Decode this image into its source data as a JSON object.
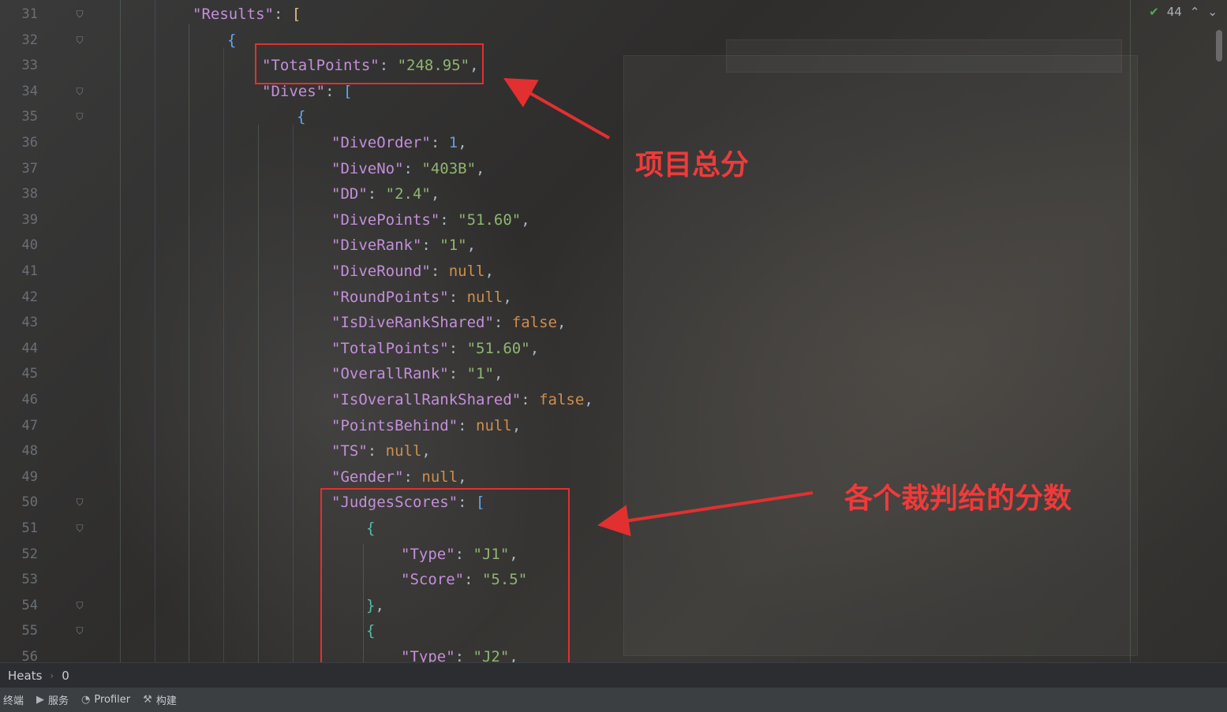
{
  "editor": {
    "line_numbers": [
      "31",
      "32",
      "33",
      "34",
      "35",
      "36",
      "37",
      "38",
      "39",
      "40",
      "41",
      "42",
      "43",
      "44",
      "45",
      "46",
      "47",
      "48",
      "49",
      "50",
      "51",
      "52",
      "53",
      "54",
      "55",
      "56"
    ],
    "lines": [
      {
        "indent": 0,
        "tokens": [
          [
            "k",
            "\"Results\""
          ],
          [
            "p",
            ": "
          ],
          [
            "br1",
            "["
          ]
        ]
      },
      {
        "indent": 1,
        "tokens": [
          [
            "br2",
            "{"
          ]
        ]
      },
      {
        "indent": 2,
        "tokens": [
          [
            "k",
            "\"TotalPoints\""
          ],
          [
            "p",
            ": "
          ],
          [
            "s",
            "\"248.95\""
          ],
          [
            "p",
            ","
          ]
        ]
      },
      {
        "indent": 2,
        "tokens": [
          [
            "k",
            "\"Dives\""
          ],
          [
            "p",
            ": "
          ],
          [
            "br2",
            "["
          ]
        ]
      },
      {
        "indent": 3,
        "tokens": [
          [
            "br2",
            "{"
          ]
        ]
      },
      {
        "indent": 4,
        "tokens": [
          [
            "k",
            "\"DiveOrder\""
          ],
          [
            "p",
            ": "
          ],
          [
            "n",
            "1"
          ],
          [
            "p",
            ","
          ]
        ]
      },
      {
        "indent": 4,
        "tokens": [
          [
            "k",
            "\"DiveNo\""
          ],
          [
            "p",
            ": "
          ],
          [
            "s",
            "\"403B\""
          ],
          [
            "p",
            ","
          ]
        ]
      },
      {
        "indent": 4,
        "tokens": [
          [
            "k",
            "\"DD\""
          ],
          [
            "p",
            ": "
          ],
          [
            "s",
            "\"2.4\""
          ],
          [
            "p",
            ","
          ]
        ]
      },
      {
        "indent": 4,
        "tokens": [
          [
            "k",
            "\"DivePoints\""
          ],
          [
            "p",
            ": "
          ],
          [
            "s",
            "\"51.60\""
          ],
          [
            "p",
            ","
          ]
        ]
      },
      {
        "indent": 4,
        "tokens": [
          [
            "k",
            "\"DiveRank\""
          ],
          [
            "p",
            ": "
          ],
          [
            "s",
            "\"1\""
          ],
          [
            "p",
            ","
          ]
        ]
      },
      {
        "indent": 4,
        "tokens": [
          [
            "k",
            "\"DiveRound\""
          ],
          [
            "p",
            ": "
          ],
          [
            "kw",
            "null"
          ],
          [
            "p",
            ","
          ]
        ]
      },
      {
        "indent": 4,
        "tokens": [
          [
            "k",
            "\"RoundPoints\""
          ],
          [
            "p",
            ": "
          ],
          [
            "kw",
            "null"
          ],
          [
            "p",
            ","
          ]
        ]
      },
      {
        "indent": 4,
        "tokens": [
          [
            "k",
            "\"IsDiveRankShared\""
          ],
          [
            "p",
            ": "
          ],
          [
            "kw",
            "false"
          ],
          [
            "p",
            ","
          ]
        ]
      },
      {
        "indent": 4,
        "tokens": [
          [
            "k",
            "\"TotalPoints\""
          ],
          [
            "p",
            ": "
          ],
          [
            "s",
            "\"51.60\""
          ],
          [
            "p",
            ","
          ]
        ]
      },
      {
        "indent": 4,
        "tokens": [
          [
            "k",
            "\"OverallRank\""
          ],
          [
            "p",
            ": "
          ],
          [
            "s",
            "\"1\""
          ],
          [
            "p",
            ","
          ]
        ]
      },
      {
        "indent": 4,
        "tokens": [
          [
            "k",
            "\"IsOverallRankShared\""
          ],
          [
            "p",
            ": "
          ],
          [
            "kw",
            "false"
          ],
          [
            "p",
            ","
          ]
        ]
      },
      {
        "indent": 4,
        "tokens": [
          [
            "k",
            "\"PointsBehind\""
          ],
          [
            "p",
            ": "
          ],
          [
            "kw",
            "null"
          ],
          [
            "p",
            ","
          ]
        ]
      },
      {
        "indent": 4,
        "tokens": [
          [
            "k",
            "\"TS\""
          ],
          [
            "p",
            ": "
          ],
          [
            "kw",
            "null"
          ],
          [
            "p",
            ","
          ]
        ]
      },
      {
        "indent": 4,
        "tokens": [
          [
            "k",
            "\"Gender\""
          ],
          [
            "p",
            ": "
          ],
          [
            "kw",
            "null"
          ],
          [
            "p",
            ","
          ]
        ]
      },
      {
        "indent": 4,
        "tokens": [
          [
            "k",
            "\"JudgesScores\""
          ],
          [
            "p",
            ": "
          ],
          [
            "br2",
            "["
          ]
        ]
      },
      {
        "indent": 5,
        "tokens": [
          [
            "br3",
            "{"
          ]
        ]
      },
      {
        "indent": 6,
        "tokens": [
          [
            "k",
            "\"Type\""
          ],
          [
            "p",
            ": "
          ],
          [
            "s",
            "\"J1\""
          ],
          [
            "p",
            ","
          ]
        ]
      },
      {
        "indent": 6,
        "tokens": [
          [
            "k",
            "\"Score\""
          ],
          [
            "p",
            ": "
          ],
          [
            "s",
            "\"5.5\""
          ]
        ]
      },
      {
        "indent": 5,
        "tokens": [
          [
            "br3",
            "}"
          ],
          [
            "p",
            ","
          ]
        ]
      },
      {
        "indent": 5,
        "tokens": [
          [
            "br3",
            "{"
          ]
        ]
      },
      {
        "indent": 6,
        "tokens": [
          [
            "k",
            "\"Type\""
          ],
          [
            "p",
            ": "
          ],
          [
            "s",
            "\"J2\""
          ],
          [
            "p",
            ","
          ]
        ]
      }
    ],
    "fold_lines": [
      "31",
      "32",
      "34",
      "35",
      "50",
      "51",
      "54",
      "55"
    ],
    "inspection_count": "44"
  },
  "annotations": {
    "total_label": "项目总分",
    "judges_label": "各个裁判给的分数"
  },
  "breadcrumb": {
    "items": [
      "Heats",
      "0"
    ]
  },
  "toolbar": {
    "items": [
      {
        "icon": "terminal-icon",
        "label": "终端"
      },
      {
        "icon": "services-icon",
        "label": "服务"
      },
      {
        "icon": "profiler-icon",
        "label": "Profiler"
      },
      {
        "icon": "build-icon",
        "label": "构建"
      }
    ]
  }
}
